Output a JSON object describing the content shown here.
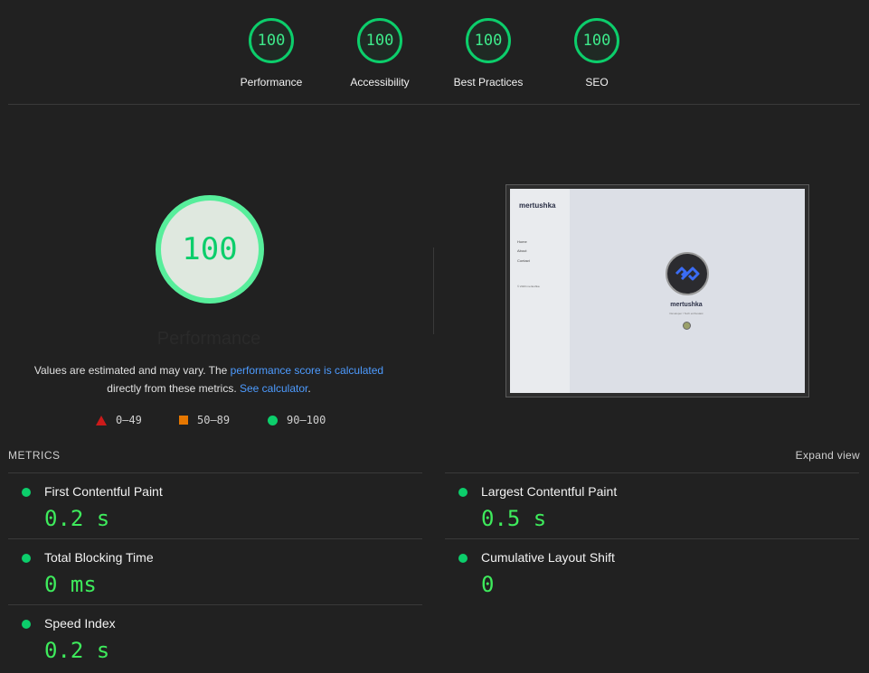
{
  "top_scores": [
    {
      "score": "100",
      "label": "Performance"
    },
    {
      "score": "100",
      "label": "Accessibility"
    },
    {
      "score": "100",
      "label": "Best Practices"
    },
    {
      "score": "100",
      "label": "SEO"
    }
  ],
  "main": {
    "score": "100",
    "label": "Performance",
    "description": {
      "text1": "Values are estimated and may vary. The ",
      "link1": "performance score is calculated",
      "text2": " directly from these metrics. ",
      "link2": "See calculator",
      "text3": "."
    },
    "legend": [
      {
        "shape": "triangle",
        "range": "0–49",
        "color": "#cc1a1a"
      },
      {
        "shape": "square",
        "range": "50–89",
        "color": "#e67700"
      },
      {
        "shape": "circle",
        "range": "90–100",
        "color": "#0cce6b"
      }
    ]
  },
  "thumbnail": {
    "brand": "mertushka",
    "nav": [
      "Home",
      "About",
      "Contact"
    ],
    "footer": "© 2023 mertushka",
    "name": "mertushka",
    "subtitle": "Developer / Tech enthusiast"
  },
  "metrics": {
    "title": "METRICS",
    "expand_label": "Expand view",
    "items": [
      {
        "name": "First Contentful Paint",
        "value": "0.2 s"
      },
      {
        "name": "Largest Contentful Paint",
        "value": "0.5 s"
      },
      {
        "name": "Total Blocking Time",
        "value": "0 ms"
      },
      {
        "name": "Cumulative Layout Shift",
        "value": "0"
      },
      {
        "name": "Speed Index",
        "value": "0.2 s"
      }
    ]
  },
  "colors": {
    "pass": "#0cce6b",
    "average": "#e67700",
    "fail": "#cc1a1a",
    "link": "#4d9bff",
    "background": "#212121"
  }
}
